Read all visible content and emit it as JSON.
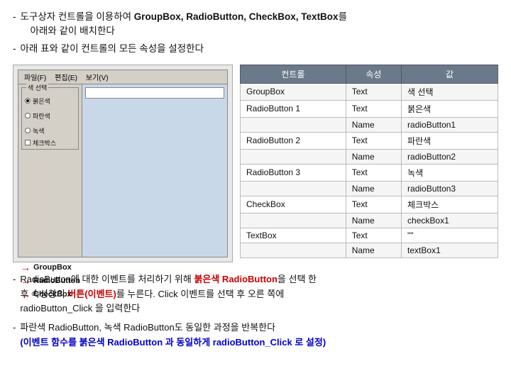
{
  "header": {
    "line1": "- 도구상자 컨트롤을 이용하여 GroupBox, RadioButton, CheckBox, TextBox를",
    "line1_indent": "아래와 같이 배치한다",
    "line2": "- 아래 표와 같이 컨트롤의 모든 속성을 설정한다"
  },
  "preview": {
    "labels": [
      {
        "id": "groupbox-label",
        "text": "GroupBox"
      },
      {
        "id": "radiobutton-label",
        "text": "RadioButton"
      },
      {
        "id": "checkbox-label",
        "text": "CheckBox"
      }
    ]
  },
  "table": {
    "headers": [
      "컨트롤",
      "속성",
      "값"
    ],
    "rows": [
      {
        "control": "GroupBox",
        "property": "Text",
        "value": "색 선택"
      },
      {
        "control": "RadioButton 1",
        "property": "Text",
        "value": "붉은색"
      },
      {
        "control": "",
        "property": "Name",
        "value": "radioButton1"
      },
      {
        "control": "RadioButton 2",
        "property": "Text",
        "value": "파란색"
      },
      {
        "control": "",
        "property": "Name",
        "value": "radioButton2"
      },
      {
        "control": "RadioButton 3",
        "property": "Text",
        "value": "녹색"
      },
      {
        "control": "",
        "property": "Name",
        "value": "radioButton3"
      },
      {
        "control": "CheckBox",
        "property": "Text",
        "value": "체크박스"
      },
      {
        "control": "",
        "property": "Name",
        "value": "checkBox1"
      },
      {
        "control": "TextBox",
        "property": "Text",
        "value": "\"\""
      },
      {
        "control": "",
        "property": "Name",
        "value": "textBox1"
      }
    ]
  },
  "bottom": {
    "item1_text": "RadioButton에 대한 이벤트를 처리하기 위해 붉은색 RadioButton을 선택 한 후 속성창의",
    "item1_btn": "버튼(이벤트)를 누른다.",
    "item1_rest": "Click 이벤트를 선택 후 오른 쪽에 radioButton_Click 을 입력한다",
    "item2_text": "파란색 RadioButton, 녹색 RadioButton도 동일한 과정을 반복한다",
    "item2_highlight": "(이벤트 함수를 붉은색 RadioButton 과 동일하게 radioButton_Click 로 설정)"
  }
}
